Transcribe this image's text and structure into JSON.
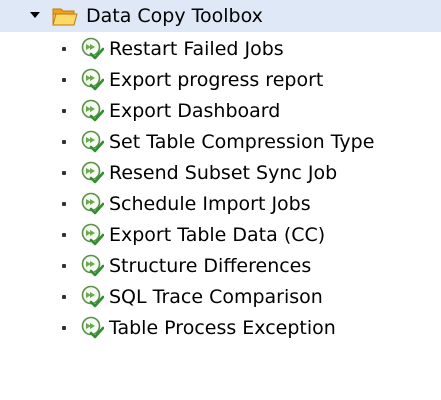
{
  "tree": {
    "root": {
      "label": "Data Copy Toolbox",
      "icon": "folder-open-icon",
      "expanded": true
    },
    "items": [
      {
        "label": "Restart Failed Jobs",
        "icon": "execute-icon"
      },
      {
        "label": "Export progress report",
        "icon": "execute-icon"
      },
      {
        "label": "Export Dashboard",
        "icon": "execute-icon"
      },
      {
        "label": "Set Table Compression Type",
        "icon": "execute-icon"
      },
      {
        "label": "Resend Subset Sync Job",
        "icon": "execute-icon"
      },
      {
        "label": "Schedule Import Jobs",
        "icon": "execute-icon"
      },
      {
        "label": "Export Table Data (CC)",
        "icon": "execute-icon"
      },
      {
        "label": "Structure Differences",
        "icon": "execute-icon"
      },
      {
        "label": "SQL Trace Comparison",
        "icon": "execute-icon"
      },
      {
        "label": "Table Process Exception",
        "icon": "execute-icon"
      }
    ]
  },
  "colors": {
    "selection_bg": "#dfe8f6",
    "folder": "#f5a623",
    "icon_green": "#4a9a3a"
  }
}
